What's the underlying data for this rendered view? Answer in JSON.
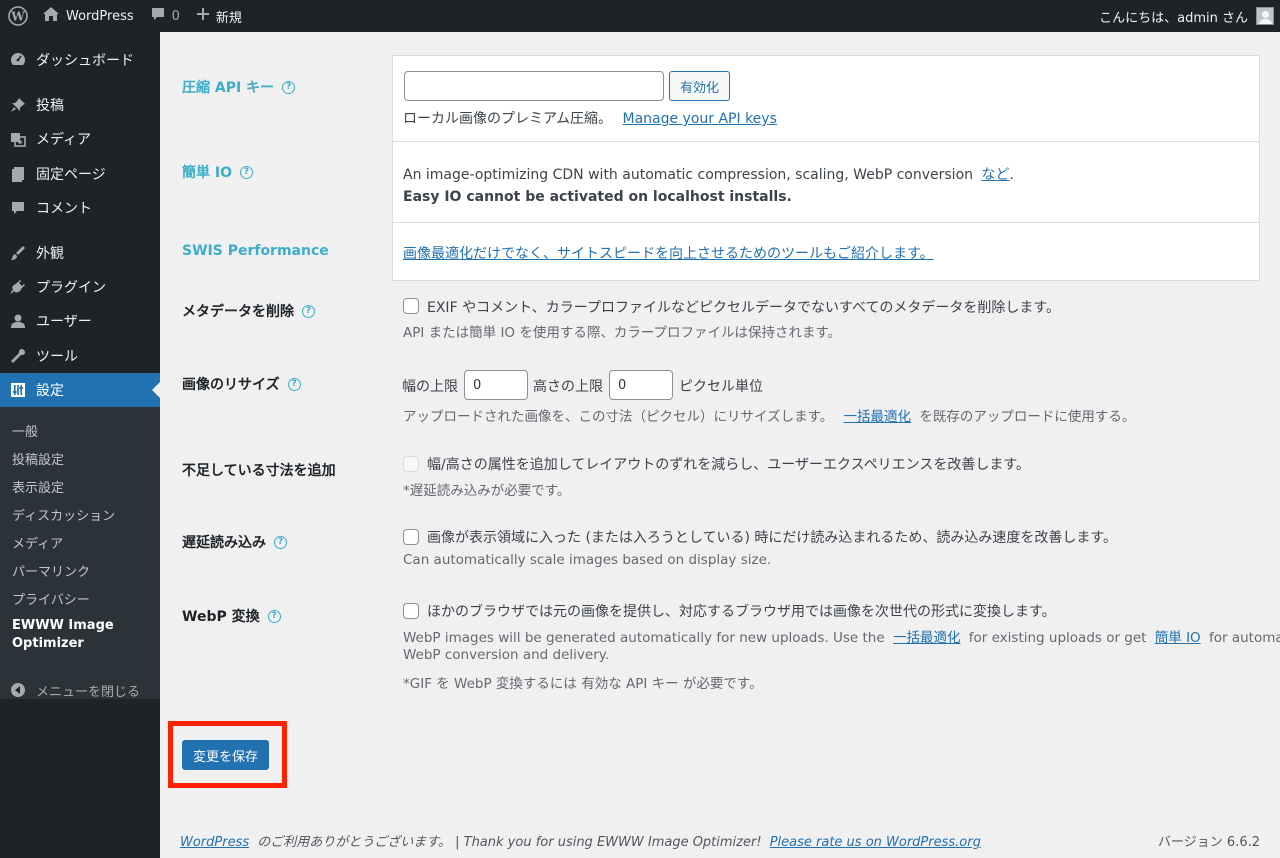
{
  "adminbar": {
    "site_name": "WordPress",
    "comment_count": "0",
    "new_label": "新規",
    "greeting": "こんにちは、admin さん"
  },
  "sidebar": {
    "items": [
      {
        "label": "ダッシュボード",
        "icon": "dashboard-icon"
      },
      {
        "label": "投稿",
        "icon": "pin-icon"
      },
      {
        "label": "メディア",
        "icon": "media-icon"
      },
      {
        "label": "固定ページ",
        "icon": "page-icon"
      },
      {
        "label": "コメント",
        "icon": "comment-icon"
      },
      {
        "label": "外観",
        "icon": "brush-icon"
      },
      {
        "label": "プラグイン",
        "icon": "plugin-icon"
      },
      {
        "label": "ユーザー",
        "icon": "user-icon"
      },
      {
        "label": "ツール",
        "icon": "wrench-icon"
      },
      {
        "label": "設定",
        "icon": "settings-icon"
      }
    ],
    "submenu": [
      "一般",
      "投稿設定",
      "表示設定",
      "ディスカッション",
      "メディア",
      "パーマリンク",
      "プライバシー",
      "EWWW Image Optimizer"
    ],
    "collapse_label": "メニューを閉じる"
  },
  "settings": {
    "api_key": {
      "label": "圧縮 API キー",
      "value": "",
      "activate_button": "有効化",
      "desc": "ローカル画像のプレミアム圧縮。",
      "link": "Manage your API keys"
    },
    "easy_io": {
      "label": "簡単 IO",
      "desc": "An image-optimizing CDN with automatic compression, scaling, WebP conversion",
      "link": "など",
      "period": ".",
      "warning": "Easy IO cannot be activated on localhost installs."
    },
    "swis": {
      "label": "SWIS Performance",
      "link": "画像最適化だけでなく、サイトスピードを向上させるためのツールもご紹介します。"
    },
    "metadata": {
      "label": "メタデータを削除",
      "checked": false,
      "text": "EXIF やコメント、カラープロファイルなどピクセルデータでないすべてのメタデータを削除します。",
      "desc": "API または簡単 IO を使用する際、カラープロファイルは保持されます。"
    },
    "resize": {
      "label": "画像のリサイズ",
      "width_label": "幅の上限",
      "width_value": "0",
      "height_label": "高さの上限",
      "height_value": "0",
      "unit_label": "ピクセル単位",
      "desc_before": "アップロードされた画像を、この寸法（ピクセル）にリサイズします。",
      "desc_link": "一括最適化",
      "desc_after": "を既存のアップロードに使用する。"
    },
    "dimensions": {
      "label": "不足している寸法を追加",
      "checked": false,
      "text": "幅/高さの属性を追加してレイアウトのずれを減らし、ユーザーエクスペリエンスを改善します。",
      "desc": "*遅延読み込みが必要です。"
    },
    "lazy": {
      "label": "遅延読み込み",
      "checked": false,
      "text": "画像が表示領域に入った (または入ろうとしている) 時にだけ読み込まれるため、読み込み速度を改善します。",
      "desc": "Can automatically scale images based on display size."
    },
    "webp": {
      "label": "WebP 変換",
      "checked": false,
      "text": "ほかのブラウザでは元の画像を提供し、対応するブラウザ用では画像を次世代の形式に変換します。",
      "desc_1": "WebP images will be generated automatically for new uploads. Use the",
      "desc_link_1": "一括最適化",
      "desc_2": "for existing uploads or get",
      "desc_link_2": "簡単 IO",
      "desc_3": "for automatic",
      "desc_line2": "WebP conversion and delivery.",
      "note": "*GIF を WebP 変換するには 有効な API キー が必要です。"
    }
  },
  "save_button": "変更を保存",
  "footer": {
    "wp_link": "WordPress",
    "thanks": "のご利用ありがとうございます。 | Thank you for using EWWW Image Optimizer!",
    "rate_link": "Please rate us on WordPress.org",
    "version": "バージョン 6.6.2"
  },
  "colors": {
    "accent": "#2271b1",
    "sidebar_bg": "#1d2327",
    "highlight": "#ff2200",
    "teal_label": "#3eadc9"
  }
}
